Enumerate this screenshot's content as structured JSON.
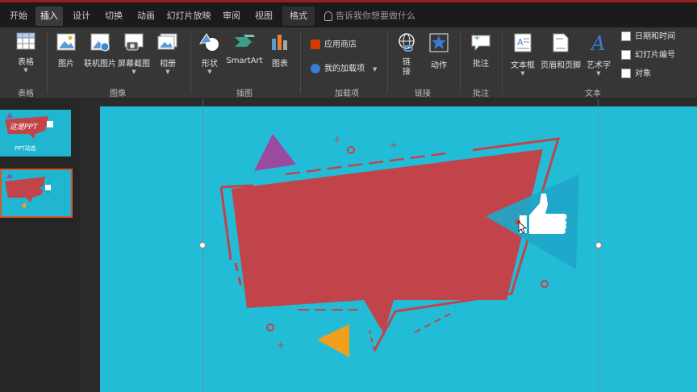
{
  "tabs": [
    {
      "label": "开始"
    },
    {
      "label": "插入"
    },
    {
      "label": "设计"
    },
    {
      "label": "切换"
    },
    {
      "label": "动画"
    },
    {
      "label": "幻灯片放映"
    },
    {
      "label": "审阅"
    },
    {
      "label": "视图"
    },
    {
      "label": "格式"
    }
  ],
  "tell_me": "告诉我你想要做什么",
  "ribbon": {
    "table": {
      "button": "表格",
      "group": "表格"
    },
    "images": {
      "picture": "图片",
      "online_picture": "联机图片",
      "screenshot": "屏幕截图",
      "album": "相册",
      "group": "图像"
    },
    "illustrations": {
      "shapes": "形状",
      "smartart": "SmartArt",
      "chart": "图表",
      "group": "插图"
    },
    "addins": {
      "store": "应用商店",
      "my_addins": "我的加载项",
      "group": "加载项"
    },
    "links": {
      "link": "链\n接",
      "action": "动作",
      "group": "链接"
    },
    "comments": {
      "comment": "批注",
      "group": "批注"
    },
    "text": {
      "textbox": "文本框",
      "header_footer": "页眉和页脚",
      "wordart": "艺术字",
      "datetime": "日期和时间",
      "slide_number": "幻灯片编号",
      "object": "对象",
      "group": "文本"
    }
  },
  "thumbnails": {
    "slide1_title": "这是PPT",
    "slide1_sub": "PPT动态"
  },
  "colors": {
    "accent_red": "#c1444b",
    "slide_bg": "#23bcd7",
    "purple": "#9a4b9f",
    "orange": "#f29f1b",
    "thumb_triangle": "#1fa6c8"
  }
}
